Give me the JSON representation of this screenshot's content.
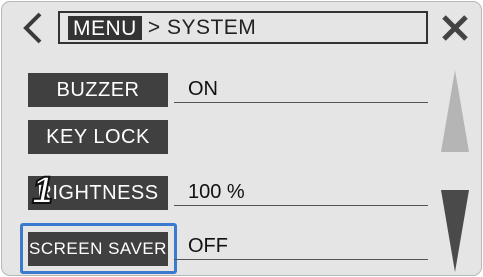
{
  "header": {
    "back_icon": "chevron-left-icon",
    "menu_tag": "MENU",
    "breadcrumb_rest": "> SYSTEM",
    "close_icon": "close-icon"
  },
  "rows": [
    {
      "label": "BUZZER",
      "value": "ON"
    },
    {
      "label": "KEY LOCK",
      "value": ""
    },
    {
      "label": "RIGHTNESS",
      "value": "100 %"
    },
    {
      "label": "SCREEN SAVER",
      "value": "OFF"
    }
  ],
  "annotation": {
    "step_number": "1"
  },
  "scroll": {
    "up_icon": "scroll-up-icon",
    "down_icon": "scroll-down-icon"
  },
  "colors": {
    "background": "#e5e5e5",
    "button": "#404040",
    "highlight": "#3a7bd0",
    "scroll_up": "#b5b5b5",
    "scroll_down": "#4a4a4a"
  }
}
